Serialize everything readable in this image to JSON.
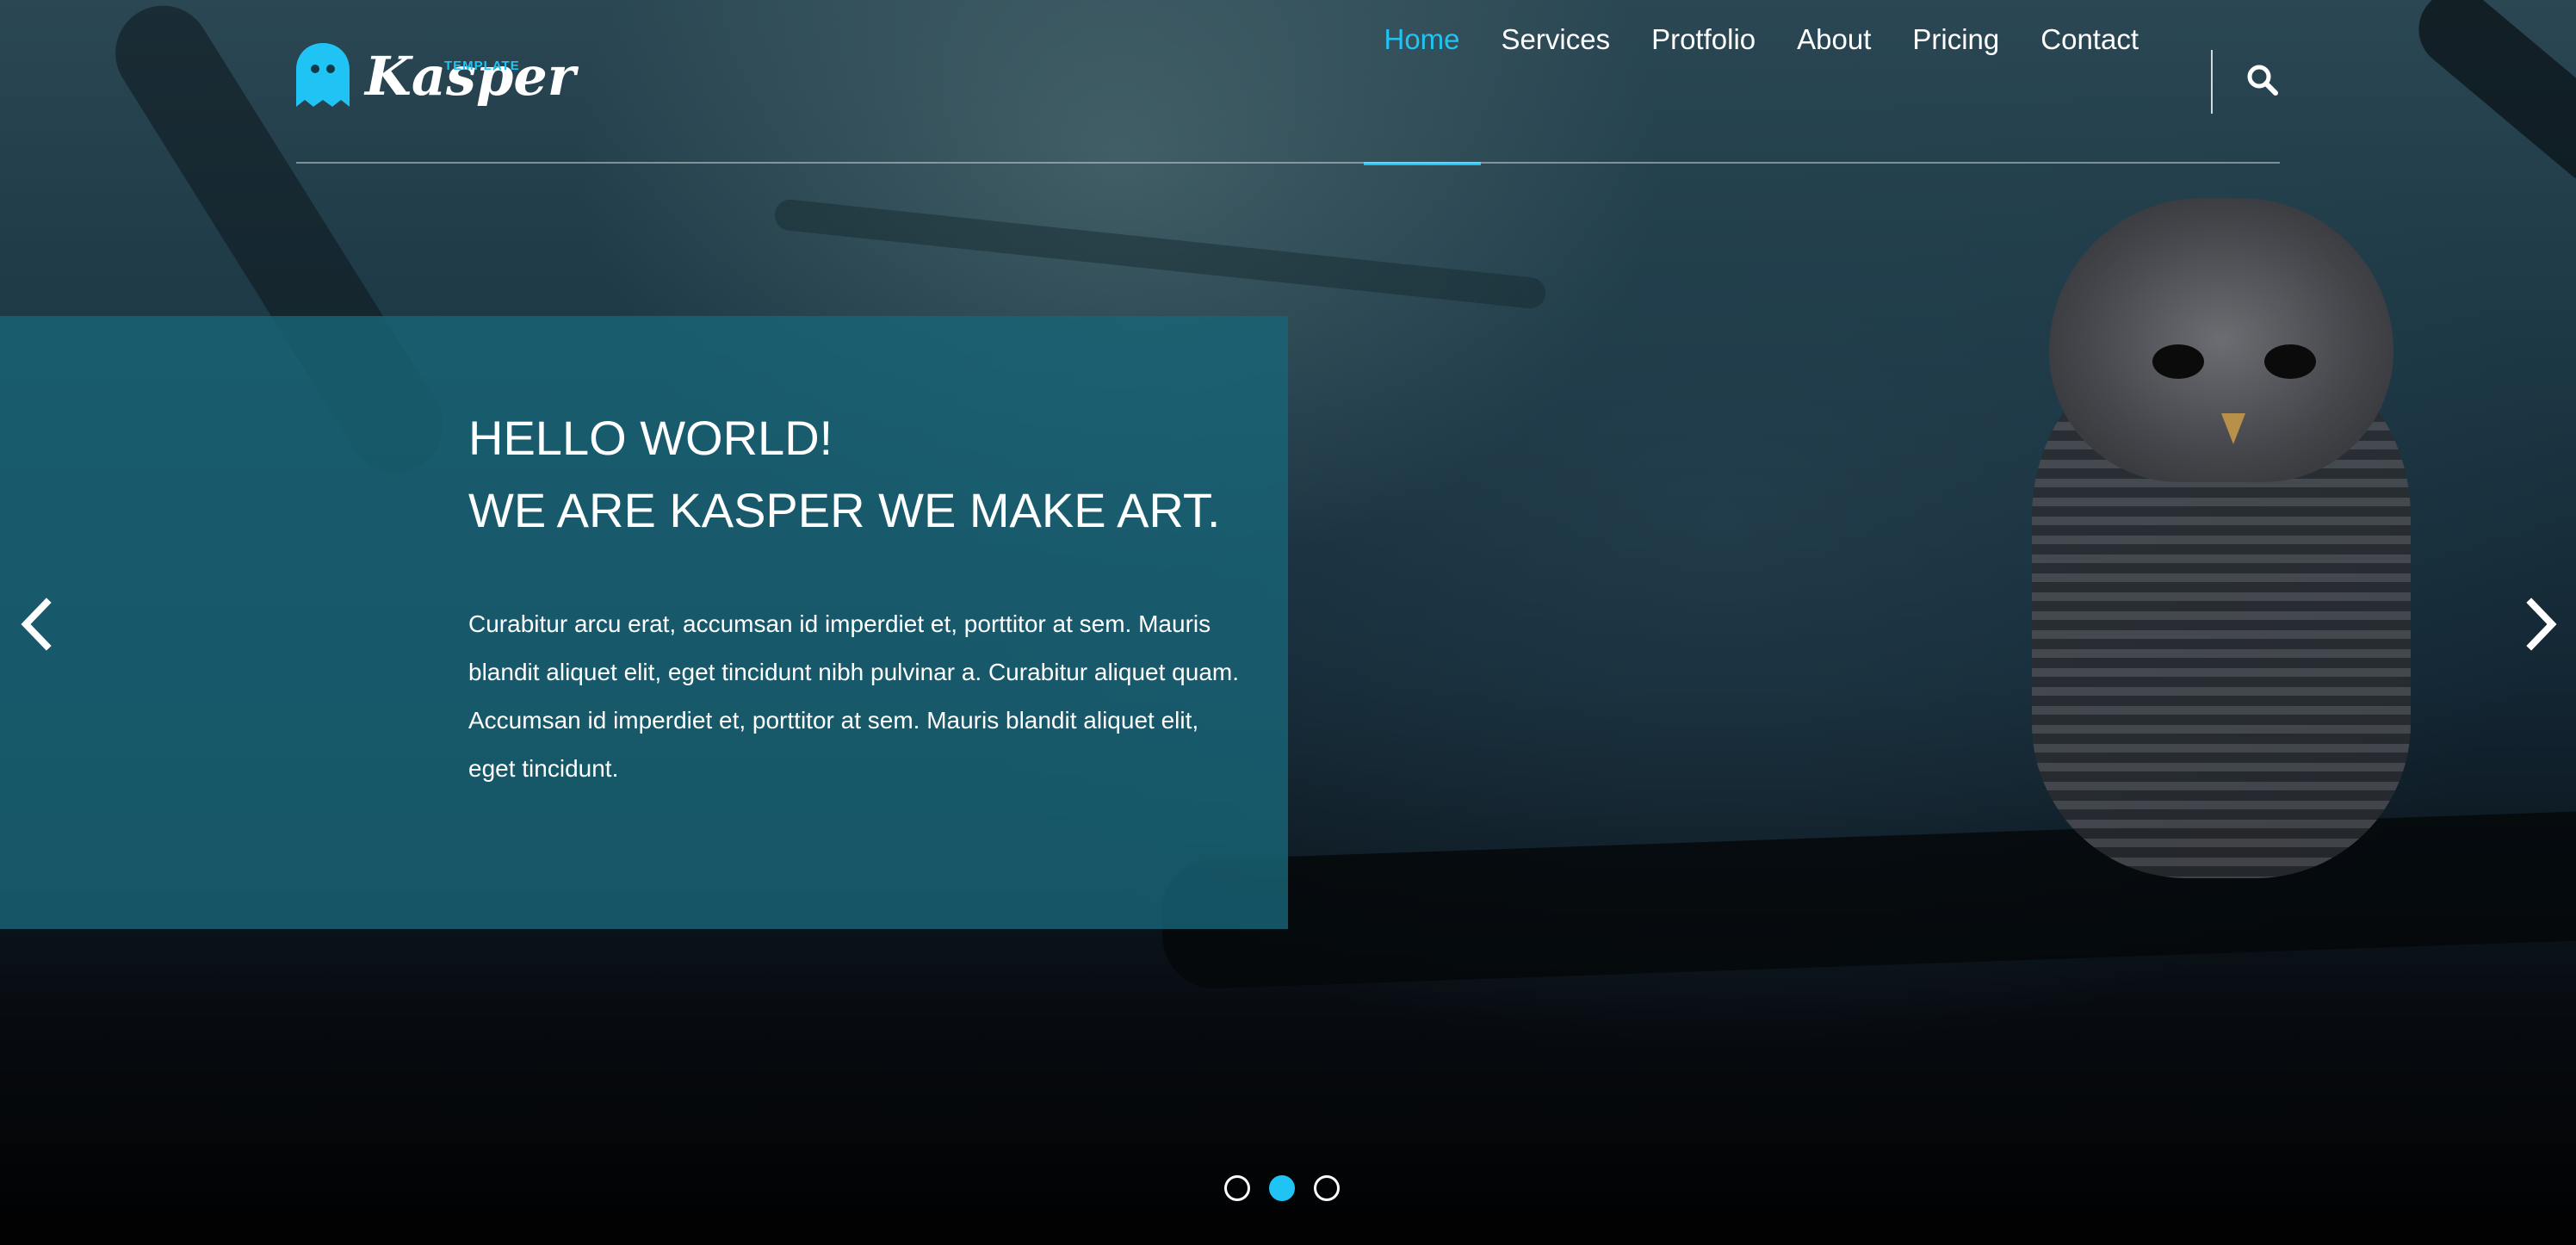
{
  "brand": {
    "name": "Kasper",
    "tagline": "TEMPLATE",
    "logo_icon": "ghost-icon",
    "accent_color": "#20c4f4"
  },
  "nav": {
    "items": [
      {
        "label": "Home",
        "active": true
      },
      {
        "label": "Services",
        "active": false
      },
      {
        "label": "Protfolio",
        "active": false
      },
      {
        "label": "About",
        "active": false
      },
      {
        "label": "Pricing",
        "active": false
      },
      {
        "label": "Contact",
        "active": false
      }
    ],
    "search_icon": "search-icon"
  },
  "slide": {
    "title_line1": "HELLO WORLD!",
    "title_line2": "WE ARE KASPER WE MAKE ART.",
    "text": "Curabitur arcu erat, accumsan id imperdiet et, porttitor at sem. Mauris blandit aliquet elit, eget tincidunt nibh pulvinar a. Curabitur aliquet quam. Accumsan id imperdiet et, porttitor at sem. Mauris blandit aliquet elit, eget tincidunt."
  },
  "slider": {
    "prev_icon": "chevron-left-icon",
    "next_icon": "chevron-right-icon",
    "bullet_count": 3,
    "active_bullet": 2
  }
}
